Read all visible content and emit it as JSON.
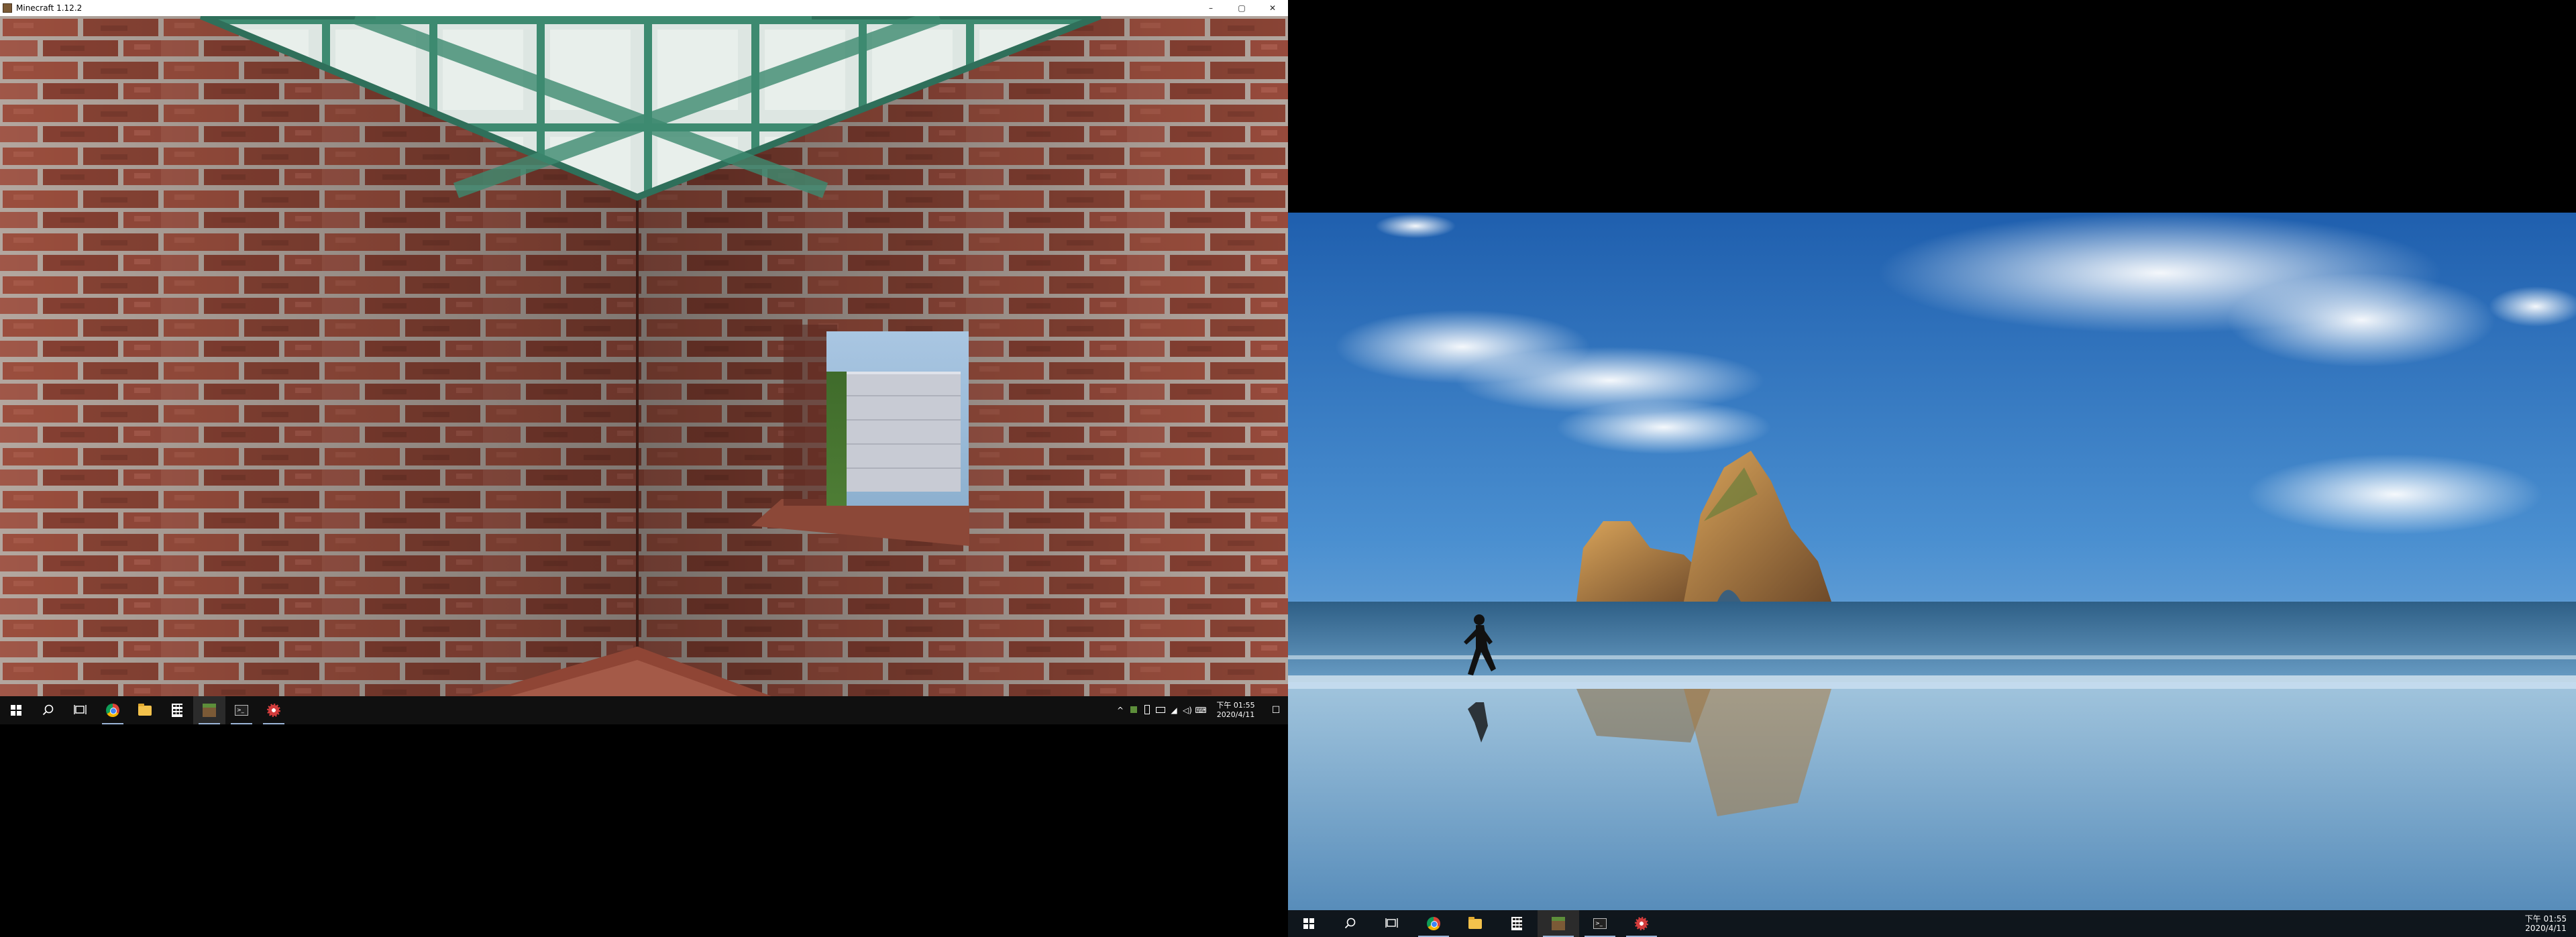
{
  "left_monitor": {
    "window": {
      "title": "Minecraft 1.12.2",
      "controls": {
        "minimize": "–",
        "maximize": "▢",
        "close": "✕"
      }
    },
    "taskbar": {
      "apps": [
        {
          "name": "start",
          "running": false
        },
        {
          "name": "search",
          "running": false
        },
        {
          "name": "task-view",
          "running": false
        },
        {
          "name": "chrome",
          "running": true
        },
        {
          "name": "file-explorer",
          "running": false
        },
        {
          "name": "calculator",
          "running": false
        },
        {
          "name": "minecraft",
          "running": true
        },
        {
          "name": "command-prompt",
          "running": true
        },
        {
          "name": "settings-app",
          "running": true
        }
      ],
      "tray": {
        "chevron": "^",
        "clock_time": "下午 01:55",
        "clock_date": "2020/4/11",
        "notifications": "☐"
      }
    }
  },
  "right_monitor": {
    "taskbar": {
      "clock_time": "下午 01:55",
      "clock_date": "2020/4/11"
    }
  },
  "colors": {
    "taskbar_bg": "#101010",
    "brick": "#9a4d3c",
    "mortar": "#b9aea6",
    "ceiling_glass": "#dfe8e4",
    "ceiling_frame": "#3f8a72"
  }
}
